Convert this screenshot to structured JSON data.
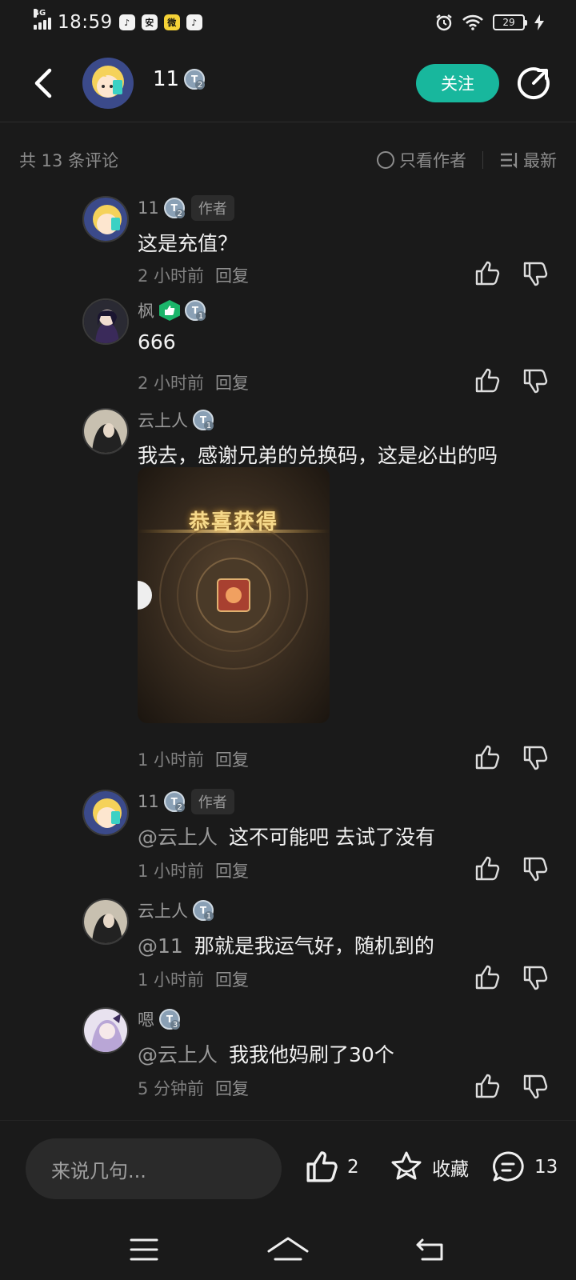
{
  "status_bar": {
    "network": "4G",
    "time": "18:59",
    "app_icons": [
      "tiktok-icon",
      "ai-icon",
      "wechat-icon",
      "tiktok-icon"
    ],
    "app_icon_glyphs": [
      "♪",
      "安",
      "微",
      "♪"
    ],
    "battery": "29"
  },
  "header": {
    "username": "11",
    "level": "2",
    "follow_label": "关注"
  },
  "sort_bar": {
    "count_text": "共 13 条评论",
    "author_only_label": "只看作者",
    "sort_label": "最新"
  },
  "comments": [
    {
      "name": "11",
      "level": "2",
      "author_tag": "作者",
      "mention": "",
      "text": "这是充值？",
      "time": "2 小时前",
      "reply_label": "回复"
    },
    {
      "name": "枫",
      "level": "1",
      "author_tag": "",
      "mention": "",
      "text": "666",
      "time": "2 小时前",
      "reply_label": "回复"
    },
    {
      "name": "云上人",
      "level": "1",
      "author_tag": "",
      "mention": "",
      "text": "我去，感谢兄弟的兑换码，这是必出的吗",
      "image_title": "恭喜获得",
      "time": "1 小时前",
      "reply_label": "回复"
    },
    {
      "name": "11",
      "level": "2",
      "author_tag": "作者",
      "mention": "@云上人",
      "text": "这不可能吧  去试了没有",
      "time": "1 小时前",
      "reply_label": "回复"
    },
    {
      "name": "云上人",
      "level": "1",
      "author_tag": "",
      "mention": "@11",
      "text": "那就是我运气好，随机到的",
      "time": "1 小时前",
      "reply_label": "回复"
    },
    {
      "name": "嗯",
      "level": "3",
      "author_tag": "",
      "mention": "@云上人",
      "text": "我我他妈刷了30个",
      "time": "5 分钟前",
      "reply_label": "回复"
    }
  ],
  "bottom_bar": {
    "input_placeholder": "来说几句...",
    "like_count": "2",
    "favorite_label": "收藏",
    "comment_count": "13"
  },
  "colors": {
    "background": "#1a1a1a",
    "accent": "#18b79d",
    "text_primary": "#f2f2f2",
    "text_secondary": "#8c8c8c"
  }
}
